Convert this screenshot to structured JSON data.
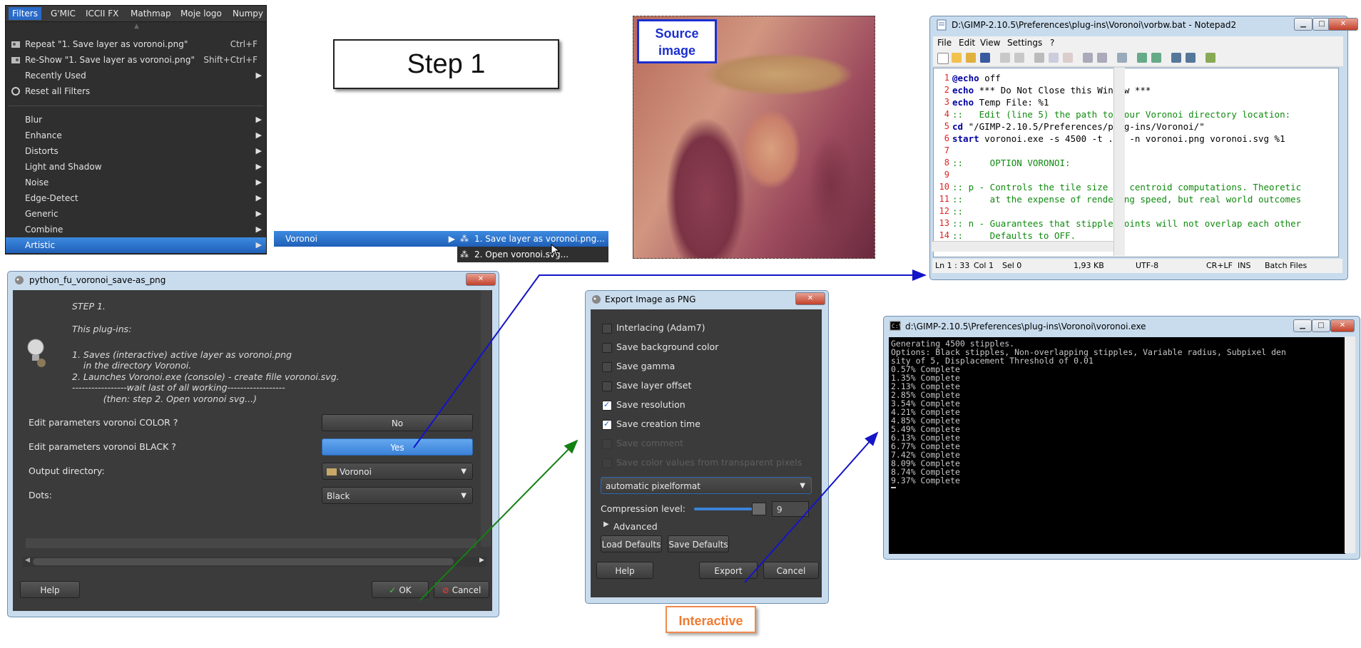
{
  "gimp_menu": {
    "menubar": [
      "Filters",
      "G'MIC",
      "ICCII FX",
      "Mathmap",
      "Moje logo",
      "Numpy"
    ],
    "repeat": {
      "label": "Repeat \"1. Save layer as voronoi.png\"",
      "shortcut": "Ctrl+F"
    },
    "reshow": {
      "label": "Re-Show \"1. Save layer as voronoi.png\"",
      "shortcut": "Shift+Ctrl+F"
    },
    "recently_used": "Recently Used",
    "reset_all": "Reset all Filters",
    "categories": [
      "Blur",
      "Enhance",
      "Distorts",
      "Light and Shadow",
      "Noise",
      "Edge-Detect",
      "Generic",
      "Combine",
      "Artistic"
    ],
    "submenu_voronoi": "Voronoi",
    "voronoi_items": [
      "1. Save layer as voronoi.png...",
      "2. Open voronoi.svg..."
    ]
  },
  "step_label": "Step 1",
  "source_image_label": {
    "line1": "Source",
    "line2": "image"
  },
  "notepad": {
    "title": "D:\\GIMP-2.10.5\\Preferences\\plug-ins\\Voronoi\\vorbw.bat - Notepad2",
    "menu": [
      "File",
      "Edit",
      "View",
      "Settings",
      "?"
    ],
    "lines": [
      {
        "n": "1",
        "kw": "@echo",
        "text": " off",
        "type": "kw"
      },
      {
        "n": "2",
        "kw": "echo",
        "text": " *** Do Not Close this Window ***",
        "type": "kw"
      },
      {
        "n": "3",
        "kw": "echo",
        "text": " Temp File: %1",
        "type": "kw"
      },
      {
        "n": "4",
        "kw": "",
        "text": "::   Edit (line 5) the path to your Voronoi directory location:",
        "type": "cm"
      },
      {
        "n": "5",
        "kw": "cd",
        "text": " \"/GIMP-2.10.5/Preferences/plug-ins/Voronoi/\"",
        "type": "kw"
      },
      {
        "n": "6",
        "kw": "start",
        "text": " voronoi.exe -s 4500 -t .01 -n voronoi.png voronoi.svg %1",
        "type": "kw"
      },
      {
        "n": "7",
        "kw": "",
        "text": "",
        "type": "cm"
      },
      {
        "n": "8",
        "kw": "",
        "text": "::     OPTION VORONOI:",
        "type": "cm"
      },
      {
        "n": "9",
        "kw": "",
        "text": "",
        "type": "cm"
      },
      {
        "n": "10",
        "kw": "",
        "text": ":: p - Controls the tile size of centroid computations. Theoretic",
        "type": "cm"
      },
      {
        "n": "11",
        "kw": "",
        "text": "::     at the expense of rendering speed, but real world outcomes",
        "type": "cm"
      },
      {
        "n": "12",
        "kw": "",
        "text": "::",
        "type": "cm"
      },
      {
        "n": "13",
        "kw": "",
        "text": ":: n - Guarantees that stipple points will not overlap each other",
        "type": "cm"
      },
      {
        "n": "14",
        "kw": "",
        "text": "::     Defaults to OFF.",
        "type": "cm"
      }
    ],
    "status": {
      "pos": "Ln 1 : 33",
      "col": "Col 1",
      "sel": "Sel 0",
      "size": "1,93 KB",
      "enc": "UTF-8",
      "eol": "CR+LF",
      "mode": "INS",
      "lang": "Batch Files"
    }
  },
  "python_fu": {
    "title": "python_fu_voronoi_save-as_png",
    "intro": [
      "STEP 1.",
      "This plug-ins:",
      "1. Saves (interactive) active layer as voronoi.png",
      "    in the directory Voronoi.",
      "2. Launches Voronoi.exe (console) - create fille voronoi.svg.",
      "-----------------wait last of all working------------------",
      "           (then: step 2. Open voronoi svg...)"
    ],
    "rows": [
      {
        "label": "Edit parameters voronoi COLOR ?",
        "value": "No"
      },
      {
        "label": "Edit parameters voronoi BLACK ?",
        "value": "Yes"
      },
      {
        "label": "Output directory:",
        "value": "Voronoi"
      },
      {
        "label": "Dots:",
        "value": "Black"
      }
    ],
    "help": "Help",
    "ok": "OK",
    "cancel": "Cancel"
  },
  "export_png": {
    "title": "Export Image as PNG",
    "options": [
      {
        "label": "Interlacing (Adam7)",
        "checked": false,
        "enabled": true
      },
      {
        "label": "Save background color",
        "checked": false,
        "enabled": true
      },
      {
        "label": "Save gamma",
        "checked": false,
        "enabled": true
      },
      {
        "label": "Save layer offset",
        "checked": false,
        "enabled": true
      },
      {
        "label": "Save resolution",
        "checked": true,
        "enabled": true
      },
      {
        "label": "Save creation time",
        "checked": true,
        "enabled": true
      },
      {
        "label": "Save comment",
        "checked": false,
        "enabled": false
      },
      {
        "label": "Save color values from transparent pixels",
        "checked": false,
        "enabled": false
      }
    ],
    "format": "automatic pixelformat",
    "compression_label": "Compression level:",
    "compression_value": "9",
    "advanced": "Advanced",
    "load_defaults": "Load Defaults",
    "save_defaults": "Save Defaults",
    "help": "Help",
    "export": "Export",
    "cancel": "Cancel"
  },
  "interactive_label": "Interactive",
  "console": {
    "title": "d:\\GIMP-2.10.5\\Preferences\\plug-ins\\Voronoi\\voronoi.exe",
    "lines": [
      "Generating 4500 stipples.",
      "Options: Black stipples, Non-overlapping stipples, Variable radius, Subpixel den",
      "sity of 5, Displacement Threshold of 0.01",
      "0.57% Complete",
      "1.35% Complete",
      "2.13% Complete",
      "2.85% Complete",
      "3.54% Complete",
      "4.21% Complete",
      "4.85% Complete",
      "5.49% Complete",
      "6.13% Complete",
      "6.77% Complete",
      "7.42% Complete",
      "8.09% Complete",
      "8.74% Complete",
      "9.37% Complete"
    ]
  },
  "colors": {
    "blue_arrow": "#1414c8",
    "green_arrow": "#138013",
    "accent": "#2a6bc9",
    "interactive": "#f07a30"
  }
}
